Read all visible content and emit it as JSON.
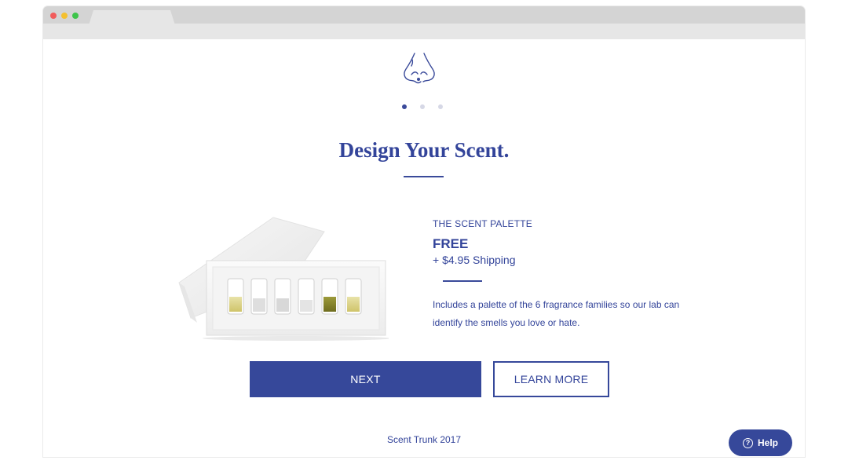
{
  "browser": {
    "window_controls": [
      "close",
      "minimize",
      "maximize"
    ],
    "tab_title": ""
  },
  "page": {
    "logo_icon": "nose-icon",
    "pagination": {
      "total": 3,
      "active_index": 0
    },
    "title": "Design Your Scent.",
    "product": {
      "image_icon": "scent-palette-box-image",
      "label": "THE SCENT PALETTE",
      "price": "FREE",
      "shipping": "+ $4.95 Shipping",
      "description": "Includes a palette of the 6 fragrance families so our lab can identify the smells you love or hate."
    },
    "buttons": {
      "next_label": "NEXT",
      "learn_more_label": "LEARN MORE"
    },
    "footer": "Scent Trunk 2017",
    "help": {
      "label": "Help",
      "icon_glyph": "?"
    }
  },
  "colors": {
    "brand_blue": "#36489a",
    "text_blue": "#33449a",
    "inactive_dot": "#d6d8e6"
  }
}
